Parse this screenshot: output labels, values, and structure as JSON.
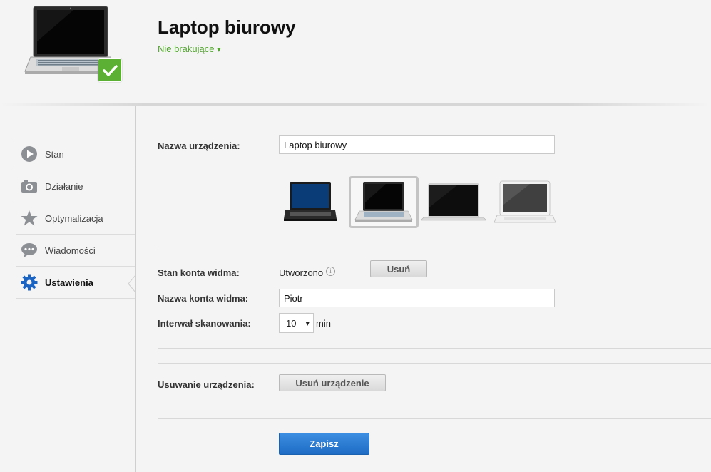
{
  "header": {
    "title": "Laptop biurowy",
    "status": "Nie brakujące",
    "status_arrow": "▾",
    "device_icon": "laptop-icon",
    "badge_icon": "checkmark-icon"
  },
  "sidebar": {
    "items": [
      {
        "label": "Stan",
        "icon": "play-icon"
      },
      {
        "label": "Działanie",
        "icon": "camera-icon"
      },
      {
        "label": "Optymalizacja",
        "icon": "star-icon"
      },
      {
        "label": "Wiadomości",
        "icon": "chat-bubble-icon"
      },
      {
        "label": "Ustawienia",
        "icon": "gear-icon",
        "active": true
      }
    ]
  },
  "settings": {
    "device_name_label": "Nazwa urządzenia:",
    "device_name_value": "Laptop biurowy",
    "device_images": [
      "laptop-dark-icon",
      "laptop-silver-icon",
      "laptop-black-thin-icon",
      "laptop-white-icon"
    ],
    "selected_image_index": 1,
    "ghost_status_label": "Stan konta widma:",
    "ghost_status_value": "Utworzono",
    "info_icon": "info-icon",
    "remove_button": "Usuń",
    "ghost_name_label": "Nazwa konta widma:",
    "ghost_name_value": "Piotr",
    "scan_interval_label": "Interwał skanowania:",
    "scan_interval_value": "10",
    "scan_interval_arrow": "▾",
    "scan_interval_unit": "min",
    "remove_device_label": "Usuwanie urządzenia:",
    "remove_device_button": "Usuń urządzenie",
    "save_button": "Zapisz"
  },
  "colors": {
    "accent_green": "#55a533",
    "save_blue": "#2a7ad3",
    "icon_gray": "#8c8f94",
    "active_blue": "#1b64c2"
  }
}
